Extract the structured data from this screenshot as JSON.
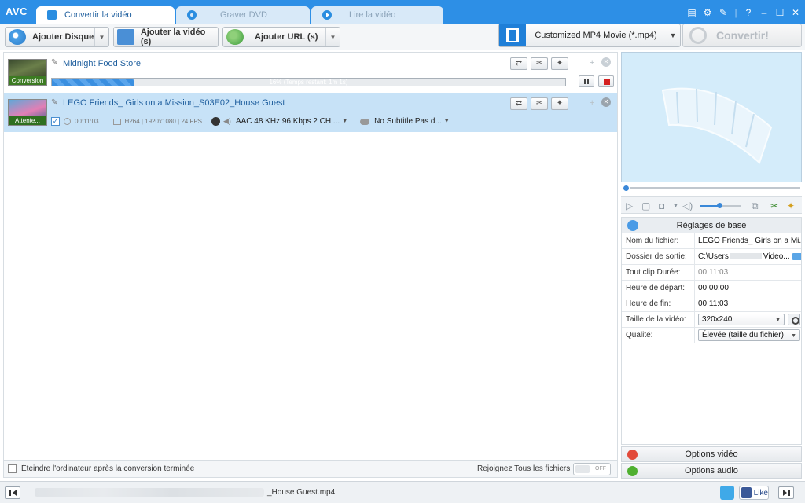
{
  "app": {
    "logo": "AVC"
  },
  "tabs": [
    {
      "label": "Convertir la vidéo",
      "active": true
    },
    {
      "label": "Graver DVD",
      "active": false
    },
    {
      "label": "Lire la vidéo",
      "active": false
    }
  ],
  "window_controls": [
    "list-icon",
    "gear-icon",
    "wrench-icon",
    "help-icon",
    "minimize-icon",
    "maximize-icon",
    "close-icon"
  ],
  "toolbar": {
    "add_disc": "Ajouter Disque",
    "add_video": "Ajouter la vidéo (s)",
    "add_url": "Ajouter URL (s)",
    "profile": "Customized MP4 Movie (*.mp4)",
    "convert": "Convertir!"
  },
  "files": [
    {
      "name": "Midnight Food Store",
      "thumb_label": "Conversion",
      "progress_text": "16% (Temps restant: 1m 1s)",
      "progress": 0.16
    },
    {
      "name": "LEGO Friends_ Girls on a Mission_S03E02_House Guest",
      "thumb_label": "Attente...",
      "duration": "00:11:03",
      "video_info": "H264 | 1920x1080 | 24 FPS",
      "audio": "AAC 48 KHz 96 Kbps 2 CH ...",
      "subtitle": "No Subtitle Pas d..."
    }
  ],
  "list_footer": {
    "shutdown": "Éteindre l'ordinateur après la conversion terminée",
    "join": "Rejoignez Tous les fichiers",
    "toggle": "OFF"
  },
  "settings": {
    "header": "Réglages de base",
    "rows": [
      {
        "key": "Nom du fichier:",
        "value": "LEGO Friends_ Girls on a Mi..."
      },
      {
        "key": "Dossier de sortie:",
        "value": "C:\\Users",
        "value_end": "Video..."
      },
      {
        "key": "Tout clip Durée:",
        "value": "00:11:03"
      },
      {
        "key": "Heure de départ:",
        "value": "00:00:00"
      },
      {
        "key": "Heure de fin:",
        "value": "00:11:03"
      },
      {
        "key": "Taille de la vidéo:",
        "value": "320x240"
      },
      {
        "key": "Qualité:",
        "value": "Élevée (taille du fichier)"
      }
    ],
    "video_options": "Options vidéo",
    "audio_options": "Options audio"
  },
  "statusbar": {
    "file": "_House Guest.mp4",
    "like": "Like"
  },
  "colors": {
    "accent": "#2d8fe6",
    "selected_row": "#c7e2f7",
    "stop": "#d42020"
  }
}
